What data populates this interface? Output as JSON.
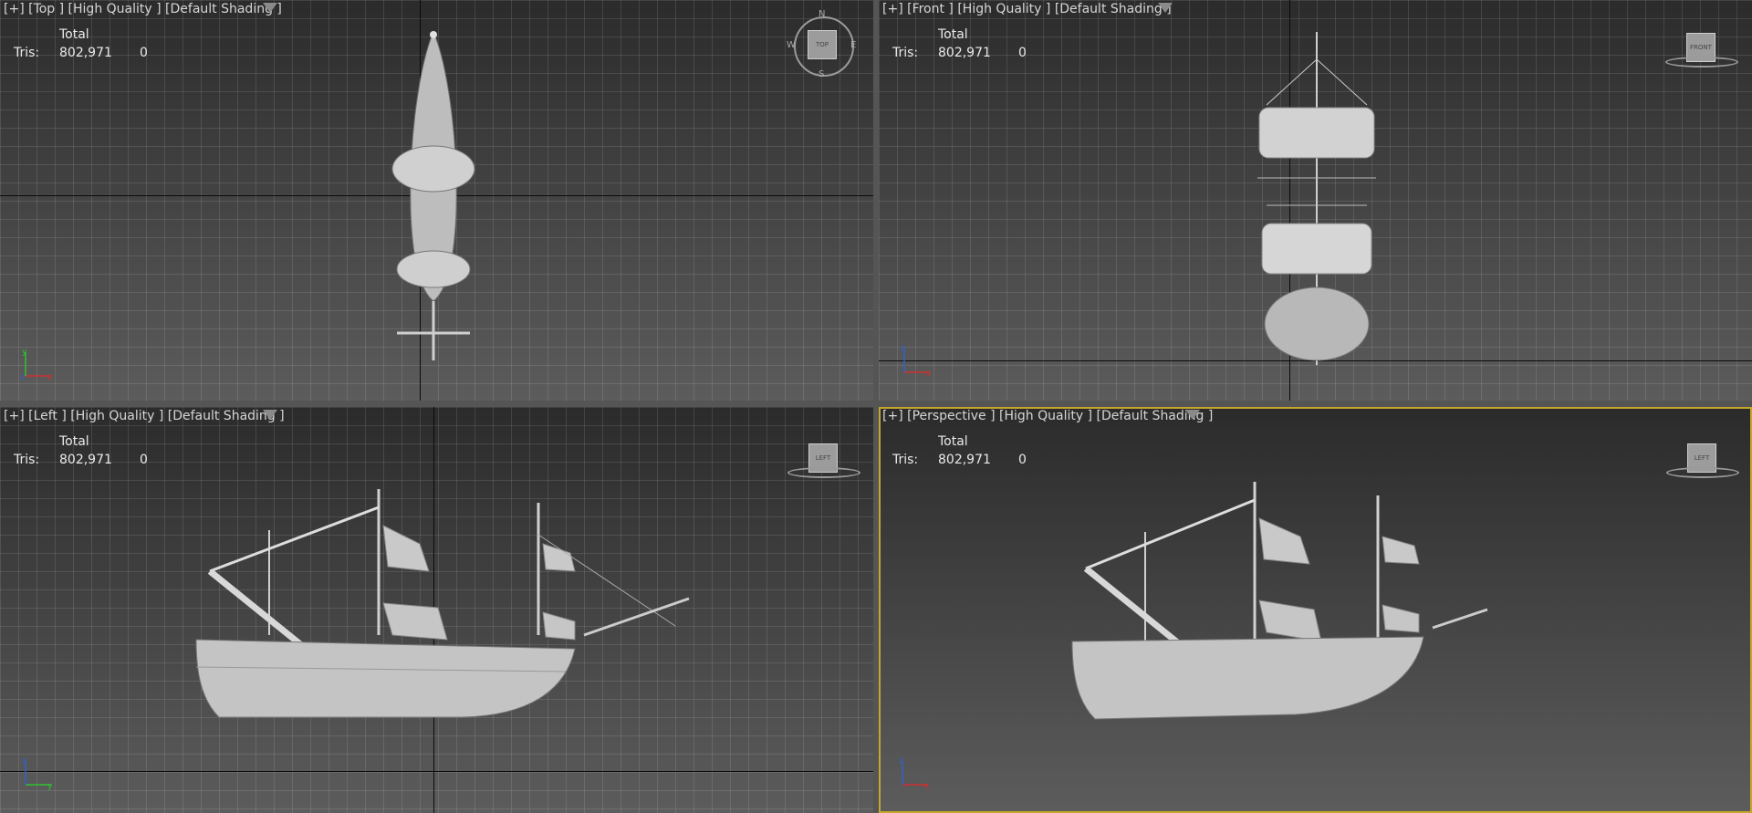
{
  "viewports": {
    "top": {
      "label": "[+] [Top ] [High Quality ] [Default Shading ]"
    },
    "front": {
      "label": "[+] [Front ] [High Quality ] [Default Shading ]"
    },
    "left": {
      "label": "[+] [Left ] [High Quality ] [Default Shading ]"
    },
    "persp": {
      "label": "[+] [Perspective ] [High Quality ] [Default Shading ]"
    }
  },
  "stats": {
    "header": "Total",
    "tris_label": "Tris:",
    "tris_total": "802,971",
    "tris_selected": "0"
  },
  "compass": {
    "n": "N",
    "s": "S",
    "e": "E",
    "w": "W",
    "cube_top": "TOP"
  },
  "viewcube": {
    "front": "FRONT",
    "left": "LEFT"
  },
  "axes": {
    "x": "x",
    "y": "y",
    "z": "z"
  },
  "colors": {
    "active_border": "#c7a62c",
    "axis_x": "#d03030",
    "axis_y": "#30c030",
    "axis_z": "#3060d0"
  },
  "icons": [
    "filter-icon",
    "viewcube-icon",
    "compass-icon",
    "axis-tripod-icon"
  ]
}
